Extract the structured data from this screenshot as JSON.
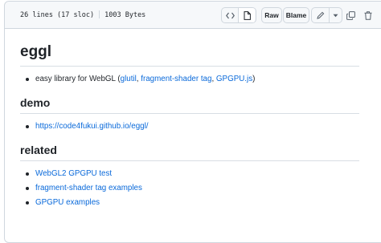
{
  "file_header": {
    "lines": "26 lines (17 sloc)",
    "size": "1003 Bytes",
    "raw_label": "Raw",
    "blame_label": "Blame"
  },
  "readme": {
    "title": "eggl",
    "intro": {
      "text": "easy library for WebGL (",
      "links": [
        "glutil",
        "fragment-shader tag",
        "GPGPU.js"
      ],
      "separator": ", ",
      "close": ")"
    },
    "demo": {
      "heading": "demo",
      "link": "https://code4fukui.github.io/eggl/"
    },
    "related": {
      "heading": "related",
      "links": [
        "WebGL2 GPGPU test",
        "fragment-shader tag examples",
        "GPGPU examples"
      ]
    }
  },
  "icons": [
    "code-icon",
    "file-icon",
    "pencil-icon",
    "dropdown-caret-icon",
    "copy-icon",
    "trash-icon"
  ]
}
